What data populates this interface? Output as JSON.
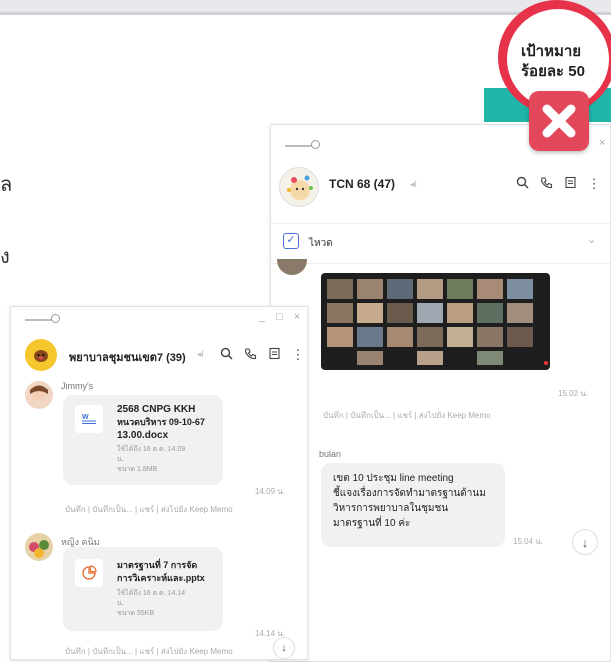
{
  "background": {
    "partial_text_1": "ล",
    "partial_text_2": "ง"
  },
  "overlay": {
    "target_line1": "เป้าหมาย",
    "target_line2": "ร้อยละ 50",
    "close_icon": "close-x-icon"
  },
  "right_window": {
    "title": "TCN 68 (47)",
    "mute_icon": "speaker-muted-icon",
    "notice_label": "ไหวด",
    "video_time": "15.02 น.",
    "video_actions": "บันทึก | บันทึกเป็น... | แชร์ | ส่งไปยัง Keep Memo",
    "msg_sender": "bulan",
    "msg_text": [
      "เขต 10 ประชุม line meeting",
      "ชี้แจงเรื่องการจัดทำมาตรฐานด้านม",
      "วิหารการพยาบาลในชุมชน",
      "มาตรฐานที่  10 ค่ะ"
    ],
    "msg_time": "15.04 น."
  },
  "left_window": {
    "title": "พยาบาลชุมชนเขต7 (39)",
    "file1": {
      "sender": "Jimmy's",
      "name": [
        "2568 CNPG KKH",
        "หนวดบริหาร 09-10-67",
        "13.00.docx"
      ],
      "meta": [
        "ใช้ได้ถึง 16 ต.ค. 14.09",
        "น.",
        "ขนาด 1.8MB"
      ],
      "time": "14.09 น.",
      "actions": "บันทึก | บันทึกเป็น... | แชร์ | ส่งไปยัง Keep Memo"
    },
    "file2": {
      "sender": "หญิง คนิม",
      "name": [
        "มาตรฐานที่ 7 การจัด",
        "การวิเคราะห์และ.pptx"
      ],
      "meta": [
        "ใช้ได้ถึง 16 ต.ค. 14.14",
        "น.",
        "ขนาด 55KB"
      ],
      "time": "14.14 น.",
      "actions": "บันทึก | บันทึกเป็น... | แชร์ | ส่งไปยัง Keep Memo"
    }
  },
  "colors": {
    "accent_red": "#e7334a",
    "teal": "#1fb5a8"
  }
}
